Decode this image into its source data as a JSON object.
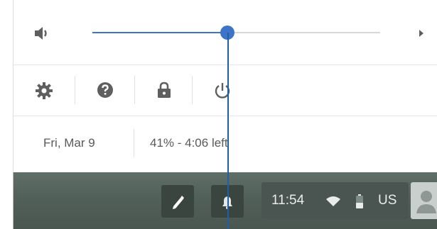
{
  "volume": {
    "level_fraction": 0.47,
    "icon": "volume-icon",
    "expand_icon": "chevron-right-icon"
  },
  "actions": [
    {
      "name": "settings",
      "icon": "gear-icon"
    },
    {
      "name": "help",
      "icon": "help-icon"
    },
    {
      "name": "lock",
      "icon": "lock-icon"
    },
    {
      "name": "power",
      "icon": "power-icon"
    }
  ],
  "status": {
    "date": "Fri, Mar 9",
    "battery": "41% - 4:06 left"
  },
  "tray": {
    "time": "11:54",
    "keyboard_layout": "US",
    "stylus_icon": "stylus-icon",
    "notification_icon": "bell-icon",
    "wifi_icon": "wifi-icon",
    "battery_icon": "battery-icon",
    "avatar_icon": "avatar-icon"
  },
  "colors": {
    "accent": "#3d74c8",
    "taskbar": "#55635d",
    "icon": "#5f5f5f"
  }
}
